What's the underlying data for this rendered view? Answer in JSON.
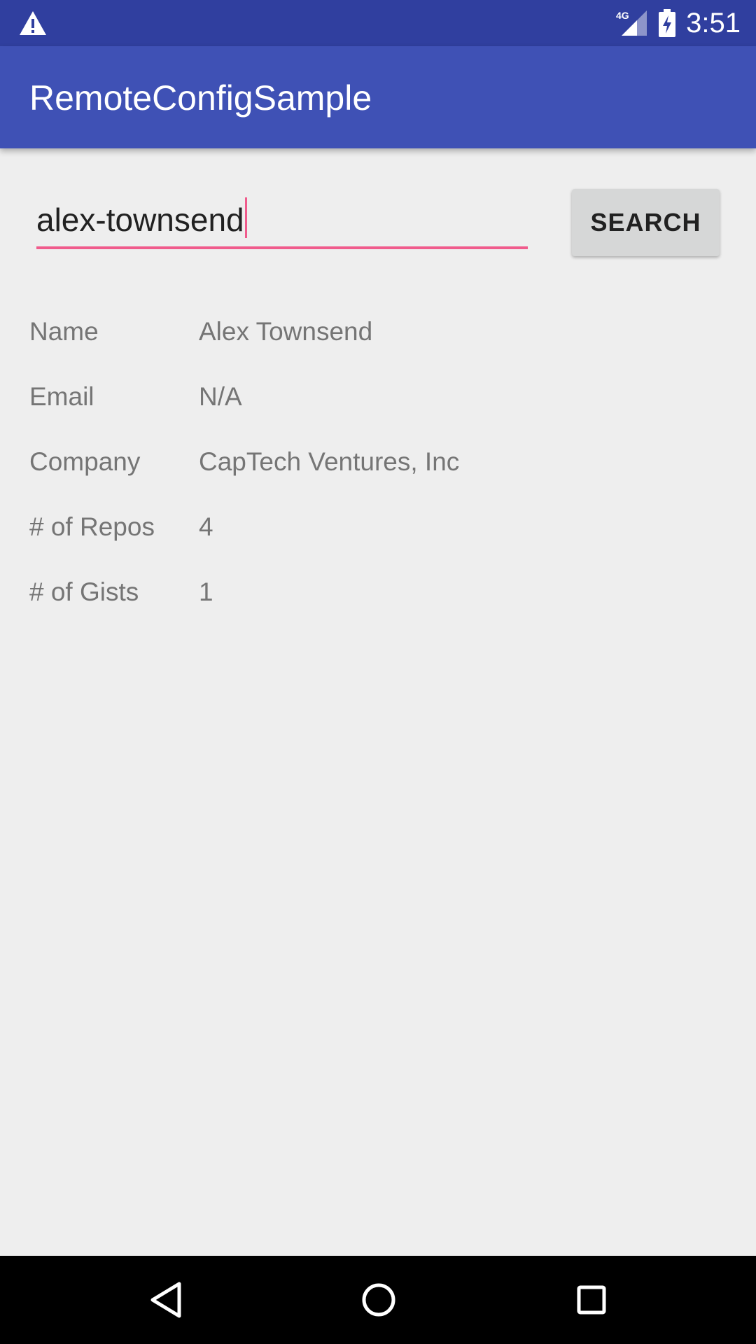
{
  "status_bar": {
    "time": "3:51",
    "network_label": "4G",
    "icons": [
      "warning-icon",
      "signal-icon",
      "battery-charging-icon"
    ]
  },
  "app_bar": {
    "title": "RemoteConfigSample"
  },
  "search": {
    "value": "alex-townsend",
    "button_label": "SEARCH"
  },
  "profile": {
    "rows": [
      {
        "label": "Name",
        "value": "Alex Townsend"
      },
      {
        "label": "Email",
        "value": "N/A"
      },
      {
        "label": "Company",
        "value": "CapTech Ventures, Inc"
      },
      {
        "label": "# of Repos",
        "value": "4"
      },
      {
        "label": "# of Gists",
        "value": "1"
      }
    ]
  },
  "nav_bar": {
    "icons": [
      "back-icon",
      "home-icon",
      "recents-icon"
    ]
  },
  "colors": {
    "status_bar": "#303f9f",
    "app_bar": "#3f51b5",
    "accent": "#f05b8c",
    "background": "#eeeeee",
    "button": "#d6d7d7"
  }
}
